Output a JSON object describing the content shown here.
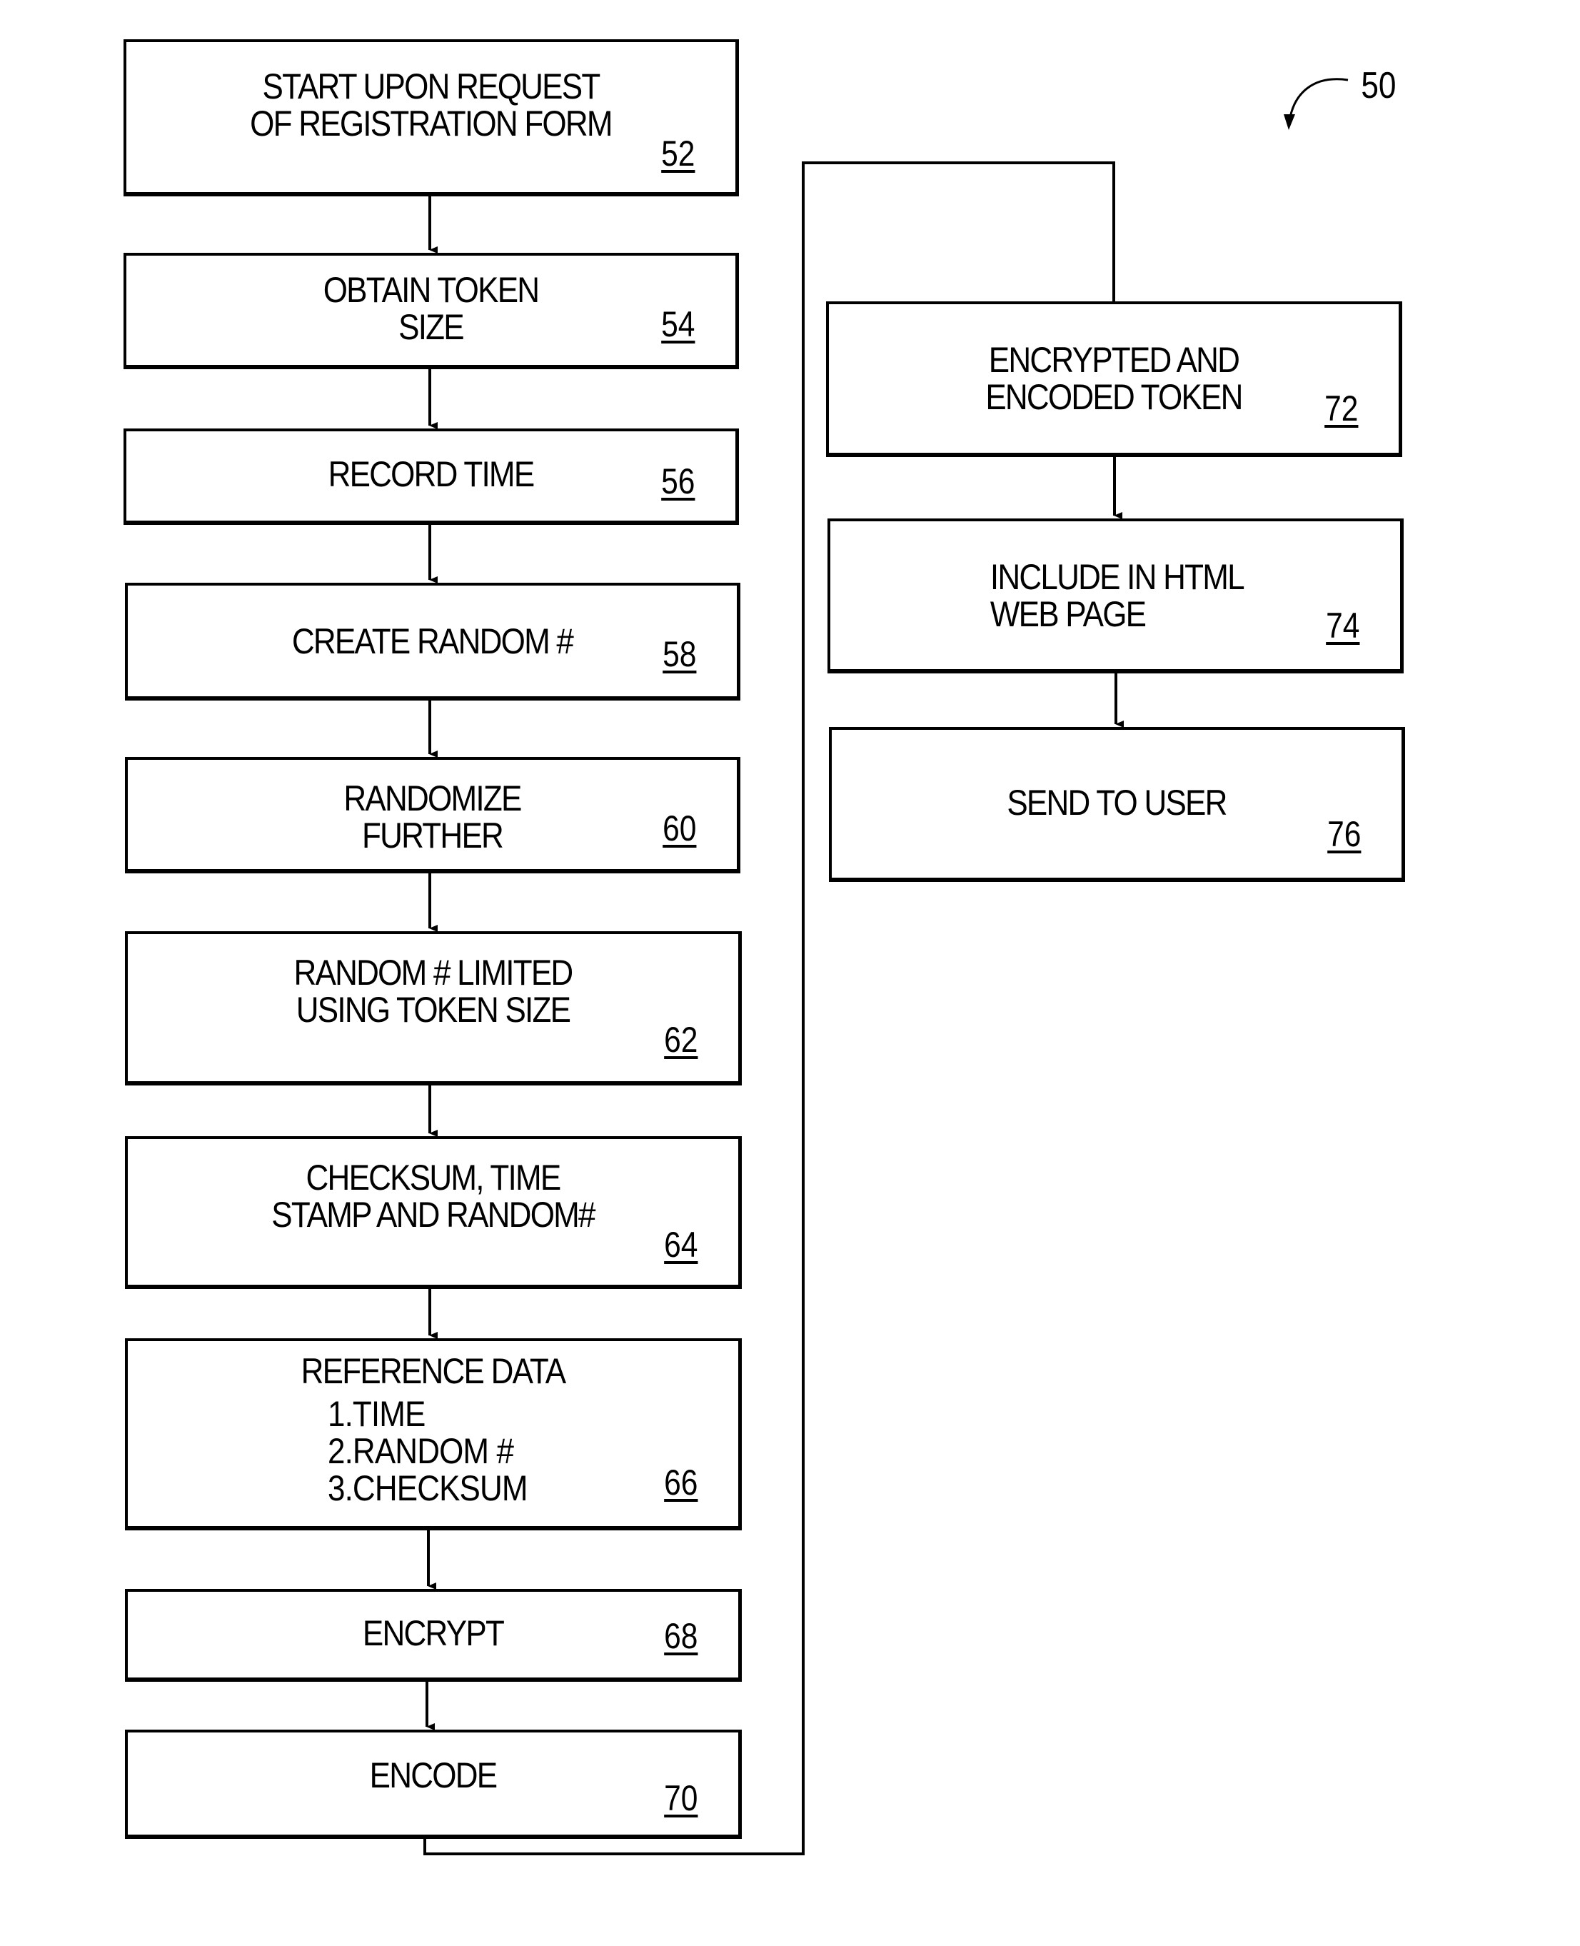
{
  "figure": {
    "ref_label": "50"
  },
  "steps": [
    {
      "id": "52",
      "lines": "START UPON REQUEST\nOF REGISTRATION FORM"
    },
    {
      "id": "54",
      "lines": "OBTAIN TOKEN\nSIZE"
    },
    {
      "id": "56",
      "lines": "RECORD TIME"
    },
    {
      "id": "58",
      "lines": "CREATE RANDOM #"
    },
    {
      "id": "60",
      "lines": "RANDOMIZE\nFURTHER"
    },
    {
      "id": "62",
      "lines": "RANDOM # LIMITED\nUSING TOKEN SIZE"
    },
    {
      "id": "64",
      "lines": "CHECKSUM, TIME\nSTAMP AND RANDOM#"
    },
    {
      "id": "66",
      "lines": "REFERENCE DATA",
      "items": [
        "1.TIME",
        "2.RANDOM #",
        "3.CHECKSUM"
      ]
    },
    {
      "id": "68",
      "lines": "ENCRYPT"
    },
    {
      "id": "70",
      "lines": "ENCODE"
    },
    {
      "id": "72",
      "lines": "ENCRYPTED AND\nENCODED TOKEN"
    },
    {
      "id": "74",
      "lines": "INCLUDE IN HTML\nWEB PAGE"
    },
    {
      "id": "76",
      "lines": "SEND TO USER"
    }
  ]
}
